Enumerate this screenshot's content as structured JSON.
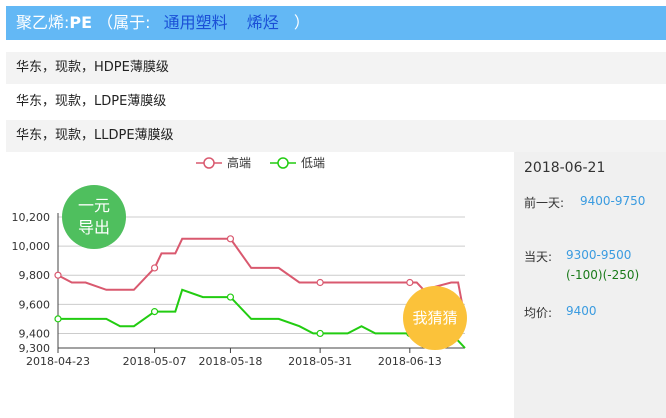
{
  "header": {
    "title_prefix": "聚乙烯:",
    "title_code": "PE",
    "belongs_open": "（属于:",
    "categories": [
      "通用塑料",
      "烯烃"
    ],
    "belongs_close": "）"
  },
  "products": [
    "华东，现款，HDPE薄膜级",
    "华东，现款，LDPE薄膜级",
    "华东，现款，LLDPE薄膜级"
  ],
  "legend": {
    "high": "高端",
    "low": "低端"
  },
  "badges": {
    "yiyuan_line1": "一元",
    "yiyuan_line2": "导出",
    "guess": "我猜猜"
  },
  "side": {
    "date": "2018-06-21",
    "prev_label": "前一天:",
    "prev_value": "9400-9750",
    "today_label": "当天:",
    "today_value": "9300-9500",
    "today_change": "(-100)(-250)",
    "avg_label": "均价:",
    "avg_value": "9400"
  },
  "chart_data": {
    "type": "line",
    "x": [
      "2018-04-23",
      "2018-04-25",
      "2018-04-27",
      "2018-04-30",
      "2018-05-02",
      "2018-05-04",
      "2018-05-07",
      "2018-05-08",
      "2018-05-10",
      "2018-05-11",
      "2018-05-14",
      "2018-05-16",
      "2018-05-18",
      "2018-05-21",
      "2018-05-23",
      "2018-05-25",
      "2018-05-28",
      "2018-05-30",
      "2018-05-31",
      "2018-06-01",
      "2018-06-04",
      "2018-06-06",
      "2018-06-08",
      "2018-06-11",
      "2018-06-13",
      "2018-06-14",
      "2018-06-15",
      "2018-06-19",
      "2018-06-20",
      "2018-06-21"
    ],
    "series": [
      {
        "name": "高端",
        "color": "#d9596f",
        "values": [
          9800,
          9750,
          9750,
          9700,
          9700,
          9700,
          9850,
          9950,
          9950,
          10050,
          10050,
          10050,
          10050,
          9850,
          9850,
          9850,
          9750,
          9750,
          9750,
          9750,
          9750,
          9750,
          9750,
          9750,
          9750,
          9750,
          9700,
          9750,
          9750,
          9500
        ]
      },
      {
        "name": "低端",
        "color": "#22cc11",
        "values": [
          9500,
          9500,
          9500,
          9500,
          9450,
          9450,
          9550,
          9550,
          9550,
          9700,
          9650,
          9650,
          9650,
          9500,
          9500,
          9500,
          9450,
          9400,
          9400,
          9400,
          9400,
          9450,
          9400,
          9400,
          9400,
          9400,
          9400,
          9400,
          9350,
          9300
        ]
      }
    ],
    "x_ticks": [
      "2018-04-23",
      "2018-05-07",
      "2018-05-18",
      "2018-05-31",
      "2018-06-13"
    ],
    "y_ticks": [
      9300,
      9400,
      9600,
      9800,
      10000,
      10200
    ],
    "y_tick_labels": [
      "9,300",
      "9,400",
      "9,600",
      "9,800",
      "10,000",
      "10,200"
    ],
    "ylim": [
      9300,
      10200
    ],
    "grid": true,
    "legend_position": "top-center"
  }
}
